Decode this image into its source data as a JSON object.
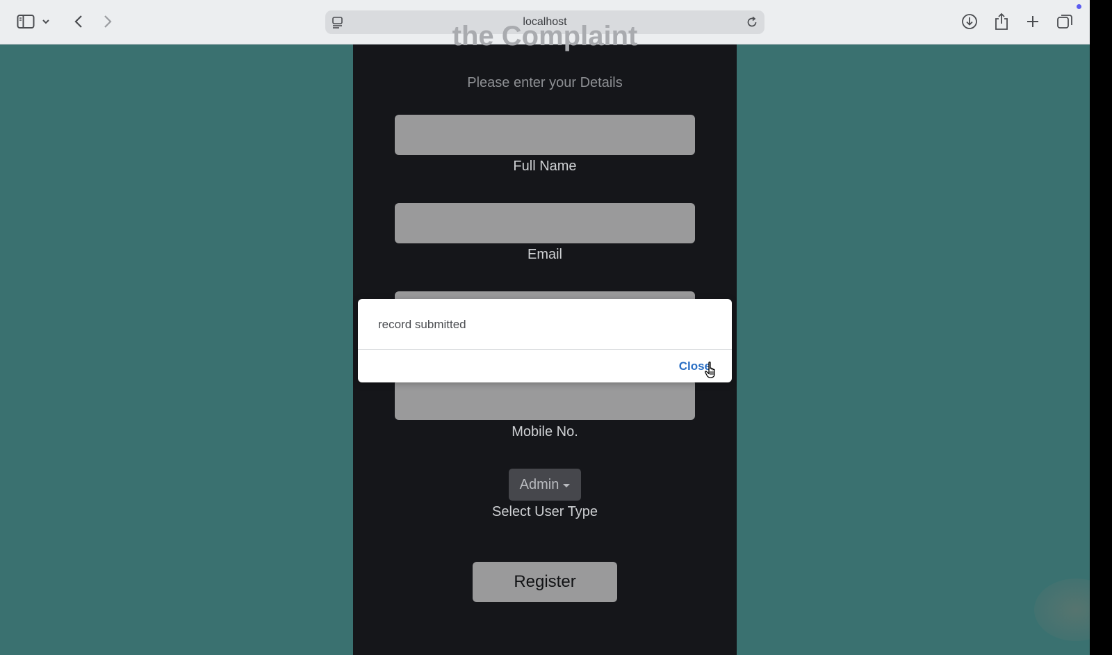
{
  "browser": {
    "url": "localhost",
    "icons": {
      "sidebar": "sidebar-icon",
      "sidebar_menu": "chevron-down-icon",
      "back": "chevron-left-icon",
      "forward": "chevron-right-icon",
      "site": "site-settings-icon",
      "reload": "reload-icon",
      "download": "download-icon",
      "share": "share-icon",
      "new_tab": "plus-icon",
      "tabs": "tab-overview-icon"
    }
  },
  "form": {
    "title": "the Complaint",
    "subtitle": "Please enter your Details",
    "fields": [
      {
        "label": "Full Name",
        "value": ""
      },
      {
        "label": "Email",
        "value": ""
      },
      {
        "label": "",
        "value": ""
      },
      {
        "label": "Mobile No.",
        "value": ""
      }
    ],
    "user_type": {
      "selected": "Admin",
      "label": "Select User Type"
    },
    "register_label": "Register"
  },
  "dialog": {
    "message": "record submitted",
    "close_label": "Close"
  },
  "colors": {
    "page_background": "#3a7170",
    "panel_background": "#15161a",
    "field_background": "#9a9a9b",
    "link": "#2a6fc4"
  }
}
